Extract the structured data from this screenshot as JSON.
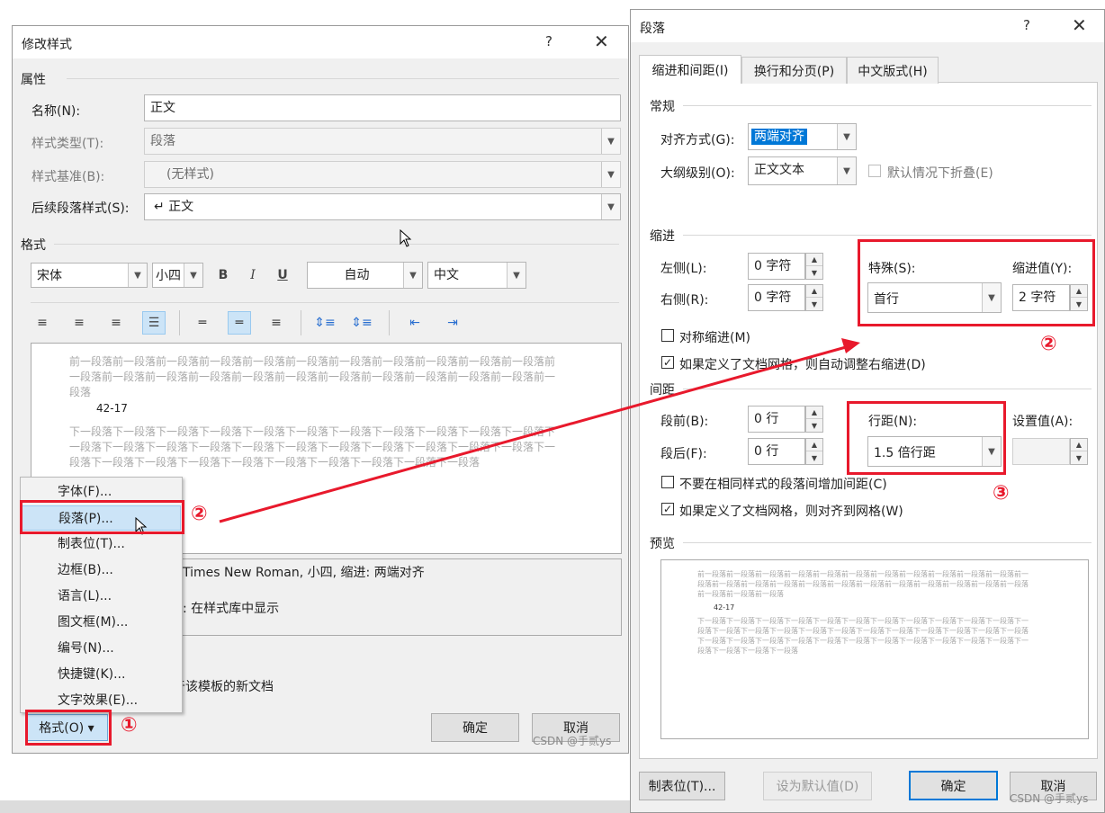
{
  "modify_style": {
    "title": "修改样式",
    "help": "?",
    "close": "✕",
    "props_header": "属性",
    "name_label": "名称(N):",
    "name_value": "正文",
    "type_label": "样式类型(T):",
    "type_value": "段落",
    "base_label": "样式基准(B):",
    "base_value": "(无样式)",
    "next_label": "后续段落样式(S):",
    "next_value": "↵ 正文",
    "format_header": "格式",
    "font_value": "宋体",
    "size_value": "小四",
    "bold": "B",
    "italic": "I",
    "underline": "U",
    "color_value": "自动",
    "lang_value": "中文",
    "preview_prev": "前一段落前一段落前一段落前一段落前一段落前一段落前一段落前一段落前一段落前一段落前一段落前一段落前一段落前一段落前一段落前一段落前一段落前一段落前一段落前一段落前一段落前一段落前一段落",
    "preview_sample": "42-17",
    "preview_next": "下一段落下一段落下一段落下一段落下一段落下一段落下一段落下一段落下一段落下一段落下一段落下一段落下一段落下一段落下一段落下一段落下一段落下一段落下一段落下一段落下一段落下一段落下一段落下一段落下一段落下一段落下一段落下一段落下一段落下一段落下一段落下一段落",
    "desc_line1": "Times New Roman, 小四, 缩进: 两端对齐",
    "desc_line2": ": 在样式库中显示",
    "template_text": "于该模板的新文档",
    "format_button": "格式(O) ▾",
    "ok": "确定",
    "cancel": "取消",
    "watermark": "CSDN @手贰ys"
  },
  "format_menu": {
    "items": [
      "字体(F)...",
      "段落(P)...",
      "制表位(T)...",
      "边框(B)...",
      "语言(L)...",
      "图文框(M)...",
      "编号(N)...",
      "快捷键(K)...",
      "文字效果(E)..."
    ],
    "selected_index": 1
  },
  "paragraph": {
    "title": "段落",
    "help": "?",
    "close": "✕",
    "tabs": [
      "缩进和间距(I)",
      "换行和分页(P)",
      "中文版式(H)"
    ],
    "general_header": "常规",
    "align_label": "对齐方式(G):",
    "align_value": "两端对齐",
    "outline_label": "大纲级别(O):",
    "outline_value": "正文文本",
    "collapse_label": "默认情况下折叠(E)",
    "indent_header": "缩进",
    "left_label": "左侧(L):",
    "left_value": "0 字符",
    "right_label": "右侧(R):",
    "right_value": "0 字符",
    "special_label": "特殊(S):",
    "special_value": "首行",
    "indent_by_label": "缩进值(Y):",
    "indent_by_value": "2 字符",
    "mirror_label": "对称缩进(M)",
    "auto_right_label": "如果定义了文档网格，则自动调整右缩进(D)",
    "spacing_header": "间距",
    "before_label": "段前(B):",
    "before_value": "0 行",
    "after_label": "段后(F):",
    "after_value": "0 行",
    "line_label": "行距(N):",
    "line_value": "1.5 倍行距",
    "at_label": "设置值(A):",
    "no_space_label": "不要在相同样式的段落间增加间距(C)",
    "snap_grid_label": "如果定义了文档网格，则对齐到网格(W)",
    "preview_header": "预览",
    "preview_prev": "前一段落前一段落前一段落前一段落前一段落前一段落前一段落前一段落前一段落前一段落前一段落前一段落前一段落前一段落前一段落前一段落前一段落前一段落前一段落前一段落前一段落前一段落前一段落前一段落前一段落前一段落",
    "preview_sample": "42-17",
    "preview_next": "下一段落下一段落下一段落下一段落下一段落下一段落下一段落下一段落下一段落下一段落下一段落下一段落下一段落下一段落下一段落下一段落下一段落下一段落下一段落下一段落下一段落下一段落下一段落下一段落下一段落下一段落下一段落下一段落下一段落下一段落下一段落下一段落下一段落下一段落下一段落下一段落下一段落下一段落",
    "tabs_button": "制表位(T)...",
    "default_button": "设为默认值(D)",
    "ok": "确定",
    "cancel": "取消",
    "watermark": "CSDN @手贰ys"
  },
  "annotations": {
    "n1": "①",
    "n2": "②",
    "n3": "③",
    "color": "#e8192c"
  }
}
